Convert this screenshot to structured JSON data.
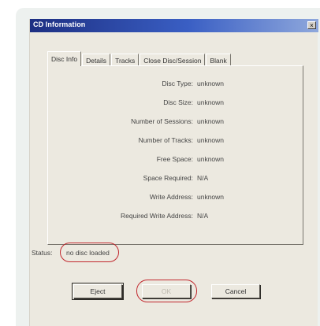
{
  "window": {
    "title": "CD Information",
    "close_glyph": "×"
  },
  "tabs": [
    {
      "label": "Disc Info",
      "active": true
    },
    {
      "label": "Details",
      "active": false
    },
    {
      "label": "Tracks",
      "active": false
    },
    {
      "label": "Close Disc/Session",
      "active": false
    },
    {
      "label": "Blank",
      "active": false
    }
  ],
  "disc_info": {
    "disc_type": {
      "label": "Disc Type:",
      "value": "unknown"
    },
    "disc_size": {
      "label": "Disc Size:",
      "value": "unknown"
    },
    "num_sessions": {
      "label": "Number of Sessions:",
      "value": "unknown"
    },
    "num_tracks": {
      "label": "Number of Tracks:",
      "value": "unknown"
    },
    "free_space": {
      "label": "Free Space:",
      "value": "unknown"
    },
    "space_required": {
      "label": "Space Required:",
      "value": "N/A"
    },
    "write_address": {
      "label": "Write Address:",
      "value": "unknown"
    },
    "req_write_address": {
      "label": "Required Write Address:",
      "value": "N/A"
    }
  },
  "status": {
    "label": "Status:",
    "value": "no disc loaded"
  },
  "buttons": {
    "eject": "Eject",
    "ok": "OK",
    "cancel": "Cancel"
  },
  "colors": {
    "title_bar_start": "#1d2f82",
    "title_bar_end": "#8fa8dc",
    "highlight_oval": "#c1272d",
    "dialog_face": "#ece9e0"
  }
}
